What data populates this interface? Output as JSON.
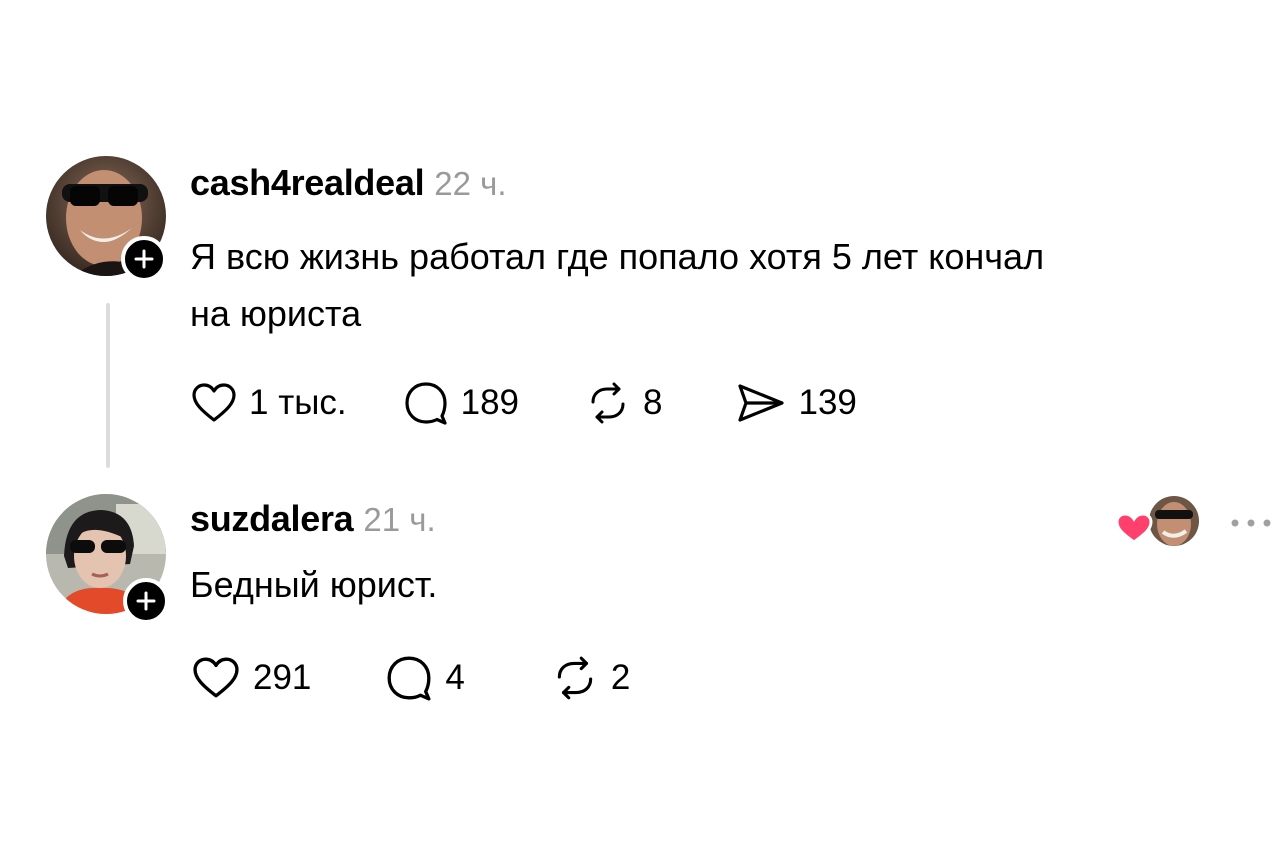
{
  "comments": [
    {
      "username": "cash4realdeal",
      "time": "22 ч.",
      "text_lines": [
        "Я всю жизнь работал где попало хотя 5 лет кончал",
        "на юриста"
      ],
      "likes": "1 тыс.",
      "replies": "189",
      "reposts": "8",
      "shares": "139"
    },
    {
      "username": "suzdalera",
      "time": "21 ч.",
      "text_lines": [
        "Бедный юрист."
      ],
      "likes": "291",
      "replies": "4",
      "reposts": "2"
    }
  ],
  "colors": {
    "heart_accent": "#ff3f6c",
    "secondary_text": "#9a9a9a",
    "thread_line": "#dcdcdc"
  },
  "icons": [
    "heart-icon",
    "comment-icon",
    "repost-icon",
    "share-icon",
    "plus-icon",
    "more-icon"
  ]
}
